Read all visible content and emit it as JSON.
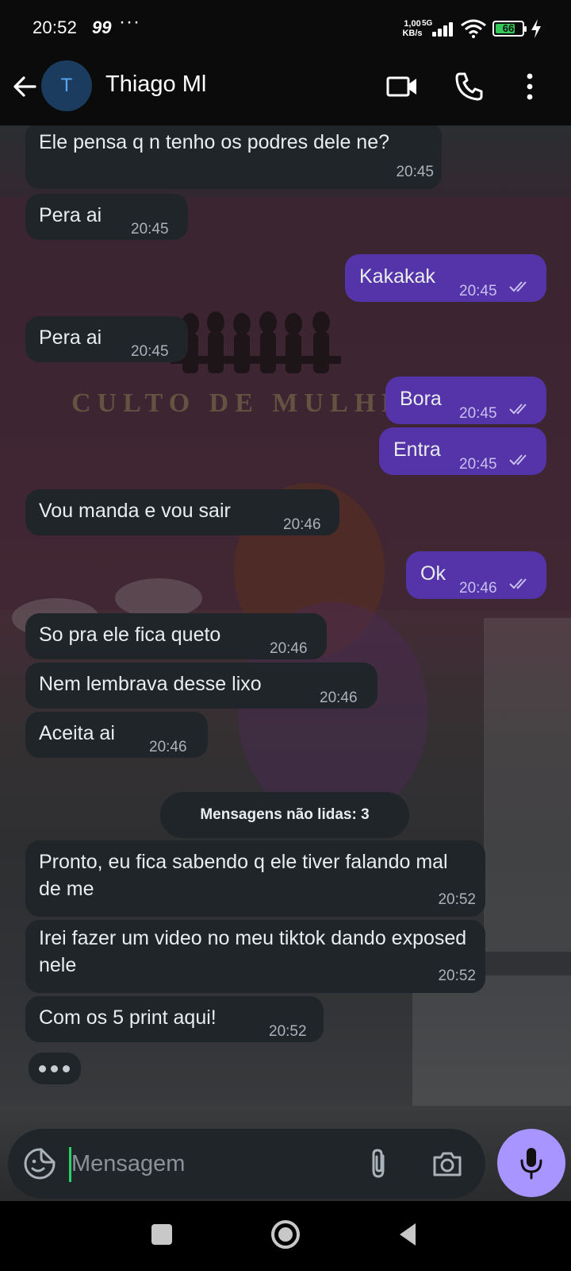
{
  "status_bar": {
    "time": "20:52",
    "badge": "99",
    "more": "···",
    "net_speed": "1,00\nKB/s",
    "network": "5G",
    "battery": "66"
  },
  "header": {
    "avatar_initial": "T",
    "contact_name": "Thiago Ml"
  },
  "messages": [
    {
      "dir": "in",
      "text": "Ele pensa q n tenho os podres dele ne?",
      "time": "20:45"
    },
    {
      "dir": "in",
      "text": "Pera ai",
      "time": "20:45"
    },
    {
      "dir": "out",
      "text": "Kakakak",
      "time": "20:45",
      "status": "read"
    },
    {
      "dir": "in",
      "text": "Pera ai",
      "time": "20:45"
    },
    {
      "dir": "out",
      "text": "Bora",
      "time": "20:45",
      "status": "read"
    },
    {
      "dir": "out",
      "text": "Entra",
      "time": "20:45",
      "status": "read"
    },
    {
      "dir": "in",
      "text": "Vou manda e vou sair",
      "time": "20:46"
    },
    {
      "dir": "out",
      "text": "Ok",
      "time": "20:46",
      "status": "read"
    },
    {
      "dir": "in",
      "text": "So pra ele fica queto",
      "time": "20:46"
    },
    {
      "dir": "in",
      "text": "Nem lembrava desse lixo",
      "time": "20:46"
    },
    {
      "dir": "in",
      "text": "Aceita ai",
      "time": "20:46"
    },
    {
      "dir": "in",
      "text": "Pronto, eu fica sabendo q ele tiver falando mal de me",
      "time": "20:52"
    },
    {
      "dir": "in",
      "text": "Irei fazer um video no meu tiktok dando exposed nele",
      "time": "20:52"
    },
    {
      "dir": "in",
      "text": "Com os 5 print aqui!",
      "time": "20:52"
    }
  ],
  "unread_divider": "Mensagens não lidas: 3",
  "composer": {
    "placeholder": "Mensagem",
    "value": ""
  },
  "colors": {
    "incoming_bubble": "#1f2528",
    "outgoing_bubble": "#5434a8",
    "mic_button": "#a895ff",
    "cursor": "#25d366"
  },
  "icons": [
    "back-arrow-icon",
    "video-call-icon",
    "phone-icon",
    "more-vertical-icon",
    "sticker-icon",
    "paperclip-icon",
    "camera-icon",
    "mic-icon",
    "nav-recents-icon",
    "nav-home-icon",
    "nav-back-icon"
  ]
}
